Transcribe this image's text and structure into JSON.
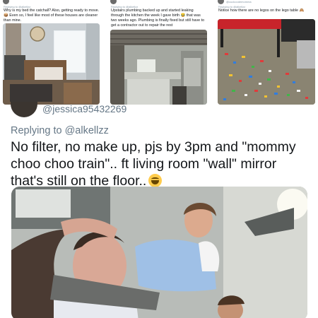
{
  "mini_tweets": [
    {
      "replying_to": "Replying to @alkellzz",
      "text": "Why is my bed the catchall? Also, getting ready to move. 📦 Even so, I feel like most of these houses are cleaner than mine.",
      "photo_alt": "bedroom"
    },
    {
      "replying_to": "Replying to @alkellzz",
      "text": "Upstairs plumbing backed up and started leaking through the kitchen the week I gave birth 😂 that was two weeks ago. Plumbing is finally fixed but still have to get a contractor out to repair the rest",
      "photo_alt": "kitchen"
    },
    {
      "handle": "@cuckoodemomma",
      "replying_to": "Replying to @alkellzz",
      "text": "Notice how there are no legos on the lego table 🙈",
      "photo_alt": "legos"
    }
  ],
  "main_tweet": {
    "handle": "@jessica95432269",
    "replying_to_prefix": "Replying to ",
    "replying_to_handle": "@alkellzz",
    "text": "No filter, no make up, pjs by 3pm and \"mommy choo choo train\".. ft living room \"wall\" mirror that's still on the floor.."
  },
  "colors": {
    "secondary_text": "#657786",
    "primary_text": "#14171a"
  }
}
